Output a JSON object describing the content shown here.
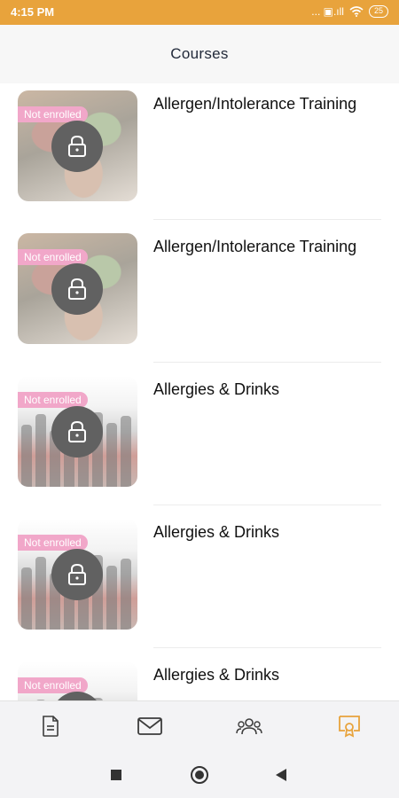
{
  "status_bar": {
    "time": "4:15 PM",
    "signal_text": "... ▣.ıll",
    "battery": "25"
  },
  "header": {
    "title": "Courses"
  },
  "courses": [
    {
      "title": "Allergen/Intolerance Training",
      "badge": "Not enrolled",
      "thumbnail": "food"
    },
    {
      "title": "Allergen/Intolerance Training",
      "badge": "Not enrolled",
      "thumbnail": "food"
    },
    {
      "title": "Allergies & Drinks",
      "badge": "Not enrolled",
      "thumbnail": "drinks"
    },
    {
      "title": "Allergies & Drinks",
      "badge": "Not enrolled",
      "thumbnail": "drinks"
    },
    {
      "title": "Allergies & Drinks",
      "badge": "Not enrolled",
      "thumbnail": "drinks"
    }
  ],
  "bottom_nav": {
    "items": [
      {
        "icon": "document-icon",
        "active": false
      },
      {
        "icon": "mail-icon",
        "active": false
      },
      {
        "icon": "group-icon",
        "active": false
      },
      {
        "icon": "certificate-icon",
        "active": true
      }
    ]
  },
  "colors": {
    "status_bar": "#e8a33c",
    "badge": "#f1a7c9",
    "active_nav": "#e8a33c",
    "inactive_nav": "#3c3c3c"
  }
}
